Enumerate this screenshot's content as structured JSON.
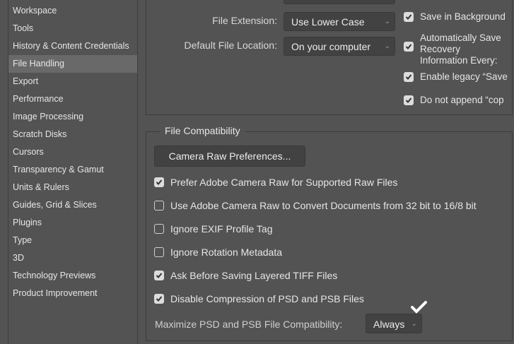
{
  "sidebar": {
    "items": [
      "Workspace",
      "Tools",
      "History & Content Credentials",
      "File Handling",
      "Export",
      "Performance",
      "Image Processing",
      "Scratch Disks",
      "Cursors",
      "Transparency & Gamut",
      "Units & Rulers",
      "Guides, Grid & Slices",
      "Plugins",
      "Type",
      "3D",
      "Technology Previews",
      "Product Improvement"
    ],
    "selected": "File Handling"
  },
  "file_saving": {
    "file_extension_label": "File Extension:",
    "file_extension_value": "Use Lower Case",
    "default_location_label": "Default File Location:",
    "default_location_value": "On your computer",
    "options": [
      {
        "label": "Save in Background",
        "checked": true
      },
      {
        "label": "Automatically Save Recovery",
        "label2": "Information Every:",
        "checked": true
      },
      {
        "label": "Enable legacy “Save",
        "checked": true
      },
      {
        "label": "Do not append “cop",
        "checked": true
      }
    ]
  },
  "file_compatibility": {
    "title": "File Compatibility",
    "camera_raw_button": "Camera Raw Preferences...",
    "options": [
      {
        "label": "Prefer Adobe Camera Raw for Supported Raw Files",
        "checked": true
      },
      {
        "label": "Use Adobe Camera Raw to Convert Documents from 32 bit to 16/8 bit",
        "checked": false
      },
      {
        "label": "Ignore EXIF Profile Tag",
        "checked": false
      },
      {
        "label": "Ignore Rotation Metadata",
        "checked": false
      },
      {
        "label": "Ask Before Saving Layered TIFF Files",
        "checked": true
      },
      {
        "label": "Disable Compression of PSD and PSB Files",
        "checked": true
      }
    ],
    "maximize_label": "Maximize PSD and PSB File Compatibility:",
    "maximize_value": "Always"
  }
}
